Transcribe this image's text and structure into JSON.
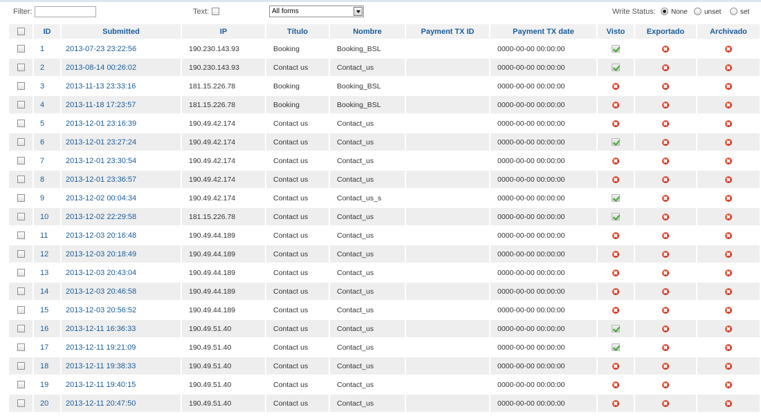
{
  "filter": {
    "label": "Filter:",
    "value": "",
    "text_label": "Text:",
    "text_checked": false,
    "form_select": "All forms"
  },
  "write_status": {
    "label": "Write Status:",
    "options": [
      "None",
      "unset",
      "set"
    ],
    "selected": "None"
  },
  "columns": {
    "id": "ID",
    "submitted": "Submitted",
    "ip": "IP",
    "titulo": "Título",
    "nombre": "Nombre",
    "payment_tx_id": "Payment TX ID",
    "payment_tx_date": "Payment TX date",
    "visto": "Visto",
    "exportado": "Exportado",
    "archivado": "Archivado"
  },
  "icons": {
    "ok": "checked-icon",
    "no": "red-x-icon"
  },
  "colors": {
    "link": "#1a5c99",
    "row_alt": "#eeeeee",
    "header_bg": "#f1f1f1"
  },
  "rows": [
    {
      "id": "1",
      "submitted": "2013-07-23 23:22:56",
      "ip": "190.230.143.93",
      "titulo": "Booking",
      "nombre": "Booking_BSL",
      "payment_tx_id": "",
      "payment_tx_date": "0000-00-00 00:00:00",
      "visto": true,
      "exportado": false,
      "archivado": false
    },
    {
      "id": "2",
      "submitted": "2013-08-14 00:26:02",
      "ip": "190.230.143.93",
      "titulo": "Contact us",
      "nombre": "Contact_us",
      "payment_tx_id": "",
      "payment_tx_date": "0000-00-00 00:00:00",
      "visto": true,
      "exportado": false,
      "archivado": false
    },
    {
      "id": "3",
      "submitted": "2013-11-13 23:33:16",
      "ip": "181.15.226.78",
      "titulo": "Booking",
      "nombre": "Booking_BSL",
      "payment_tx_id": "",
      "payment_tx_date": "0000-00-00 00:00:00",
      "visto": false,
      "exportado": false,
      "archivado": false
    },
    {
      "id": "4",
      "submitted": "2013-11-18 17:23:57",
      "ip": "181.15.226.78",
      "titulo": "Booking",
      "nombre": "Booking_BSL",
      "payment_tx_id": "",
      "payment_tx_date": "0000-00-00 00:00:00",
      "visto": false,
      "exportado": false,
      "archivado": false
    },
    {
      "id": "5",
      "submitted": "2013-12-01 23:16:39",
      "ip": "190.49.42.174",
      "titulo": "Contact us",
      "nombre": "Contact_us",
      "payment_tx_id": "",
      "payment_tx_date": "0000-00-00 00:00:00",
      "visto": false,
      "exportado": false,
      "archivado": false
    },
    {
      "id": "6",
      "submitted": "2013-12-01 23:27:24",
      "ip": "190.49.42.174",
      "titulo": "Contact us",
      "nombre": "Contact_us",
      "payment_tx_id": "",
      "payment_tx_date": "0000-00-00 00:00:00",
      "visto": true,
      "exportado": false,
      "archivado": false
    },
    {
      "id": "7",
      "submitted": "2013-12-01 23:30:54",
      "ip": "190.49.42.174",
      "titulo": "Contact us",
      "nombre": "Contact_us",
      "payment_tx_id": "",
      "payment_tx_date": "0000-00-00 00:00:00",
      "visto": false,
      "exportado": false,
      "archivado": false
    },
    {
      "id": "8",
      "submitted": "2013-12-01 23:36:57",
      "ip": "190.49.42.174",
      "titulo": "Contact us",
      "nombre": "Contact_us",
      "payment_tx_id": "",
      "payment_tx_date": "0000-00-00 00:00:00",
      "visto": false,
      "exportado": false,
      "archivado": false
    },
    {
      "id": "9",
      "submitted": "2013-12-02 00:04:34",
      "ip": "190.49.42.174",
      "titulo": "Contact us",
      "nombre": "Contact_us_s",
      "payment_tx_id": "",
      "payment_tx_date": "0000-00-00 00:00:00",
      "visto": true,
      "exportado": false,
      "archivado": false
    },
    {
      "id": "10",
      "submitted": "2013-12-02 22:29:58",
      "ip": "181.15.226.78",
      "titulo": "Contact us",
      "nombre": "Contact_us",
      "payment_tx_id": "",
      "payment_tx_date": "0000-00-00 00:00:00",
      "visto": true,
      "exportado": false,
      "archivado": false
    },
    {
      "id": "11",
      "submitted": "2013-12-03 20:16:48",
      "ip": "190.49.44.189",
      "titulo": "Contact us",
      "nombre": "Contact_us",
      "payment_tx_id": "",
      "payment_tx_date": "0000-00-00 00:00:00",
      "visto": false,
      "exportado": false,
      "archivado": false
    },
    {
      "id": "12",
      "submitted": "2013-12-03 20:18:49",
      "ip": "190.49.44.189",
      "titulo": "Contact us",
      "nombre": "Contact_us",
      "payment_tx_id": "",
      "payment_tx_date": "0000-00-00 00:00:00",
      "visto": false,
      "exportado": false,
      "archivado": false
    },
    {
      "id": "13",
      "submitted": "2013-12-03 20:43:04",
      "ip": "190.49.44.189",
      "titulo": "Contact us",
      "nombre": "Contact_us",
      "payment_tx_id": "",
      "payment_tx_date": "0000-00-00 00:00:00",
      "visto": false,
      "exportado": false,
      "archivado": false
    },
    {
      "id": "14",
      "submitted": "2013-12-03 20:46:58",
      "ip": "190.49.44.189",
      "titulo": "Contact us",
      "nombre": "Contact_us",
      "payment_tx_id": "",
      "payment_tx_date": "0000-00-00 00:00:00",
      "visto": false,
      "exportado": false,
      "archivado": false
    },
    {
      "id": "15",
      "submitted": "2013-12-03 20:56:52",
      "ip": "190.49.44.189",
      "titulo": "Contact us",
      "nombre": "Contact_us",
      "payment_tx_id": "",
      "payment_tx_date": "0000-00-00 00:00:00",
      "visto": false,
      "exportado": false,
      "archivado": false
    },
    {
      "id": "16",
      "submitted": "2013-12-11 16:36:33",
      "ip": "190.49.51.40",
      "titulo": "Contact us",
      "nombre": "Contact_us",
      "payment_tx_id": "",
      "payment_tx_date": "0000-00-00 00:00:00",
      "visto": true,
      "exportado": false,
      "archivado": false
    },
    {
      "id": "17",
      "submitted": "2013-12-11 19:21:09",
      "ip": "190.49.51.40",
      "titulo": "Contact us",
      "nombre": "Contact_us",
      "payment_tx_id": "",
      "payment_tx_date": "0000-00-00 00:00:00",
      "visto": true,
      "exportado": false,
      "archivado": false
    },
    {
      "id": "18",
      "submitted": "2013-12-11 19:38:33",
      "ip": "190.49.51.40",
      "titulo": "Contact us",
      "nombre": "Contact_us",
      "payment_tx_id": "",
      "payment_tx_date": "0000-00-00 00:00:00",
      "visto": false,
      "exportado": false,
      "archivado": false
    },
    {
      "id": "19",
      "submitted": "2013-12-11 19:40:15",
      "ip": "190.49.51.40",
      "titulo": "Contact us",
      "nombre": "Contact_us",
      "payment_tx_id": "",
      "payment_tx_date": "0000-00-00 00:00:00",
      "visto": false,
      "exportado": false,
      "archivado": false
    },
    {
      "id": "20",
      "submitted": "2013-12-11 20:47:50",
      "ip": "190.49.51.40",
      "titulo": "Contact us",
      "nombre": "Contact_us",
      "payment_tx_id": "",
      "payment_tx_date": "0000-00-00 00:00:00",
      "visto": false,
      "exportado": false,
      "archivado": false
    }
  ]
}
